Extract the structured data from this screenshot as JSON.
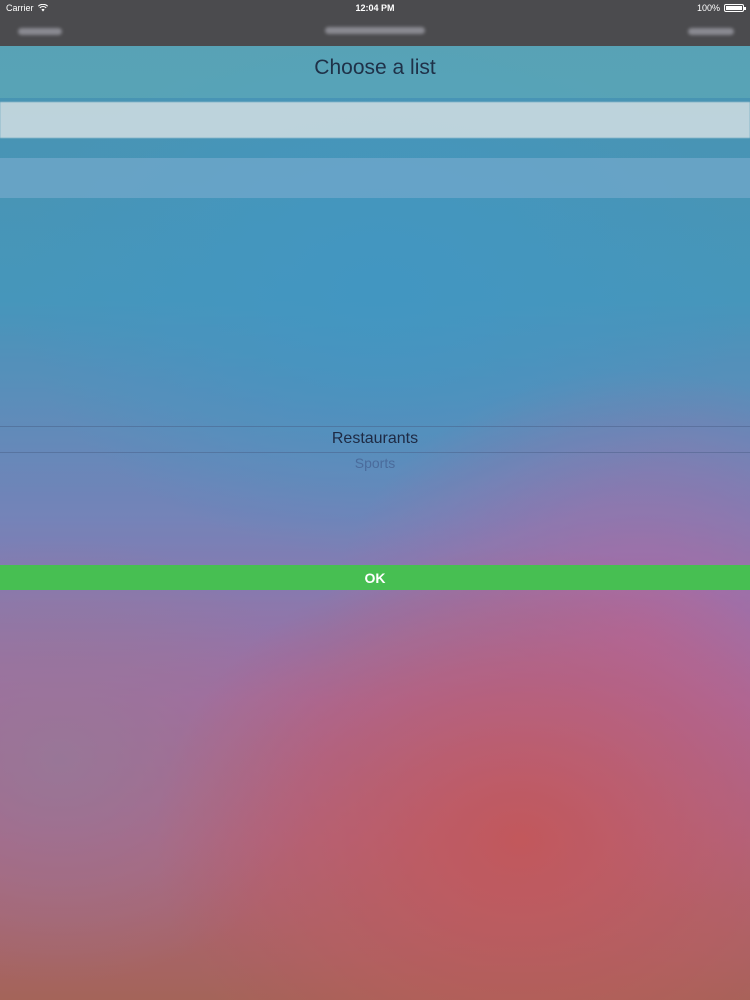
{
  "status_bar": {
    "carrier": "Carrier",
    "time": "12:04 PM",
    "battery": "100%"
  },
  "title": "Choose a list",
  "picker": {
    "selected": "Restaurants",
    "next": "Sports"
  },
  "ok_button": "OK",
  "colors": {
    "ok_button": "#47bf52",
    "status_bar": "#4b4b4e"
  }
}
